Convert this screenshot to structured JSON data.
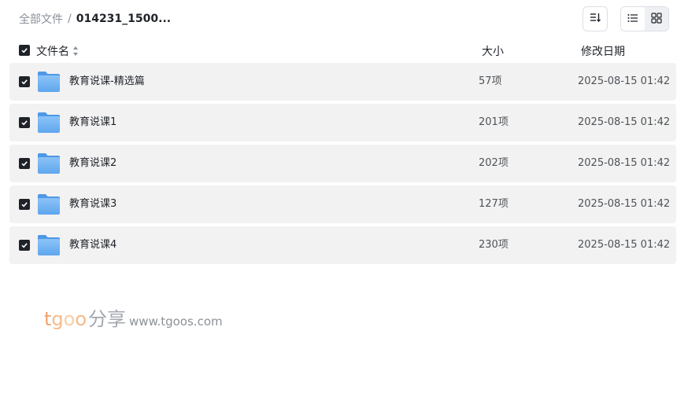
{
  "breadcrumb": {
    "root": "全部文件",
    "separator": "/",
    "current": "014231_1500..."
  },
  "toolbar": {
    "sort_icon": "sort-descending-icon",
    "view_list_icon": "list-view-icon",
    "view_grid_icon": "grid-view-icon",
    "active_view": "list"
  },
  "table": {
    "headers": {
      "name": "文件名",
      "size": "大小",
      "date": "修改日期"
    },
    "select_all_checked": true,
    "rows": [
      {
        "name": "教育说课-精选篇",
        "size": "57项",
        "date": "2025-08-15 01:42",
        "checked": true,
        "icon": "folder-icon"
      },
      {
        "name": "教育说课1",
        "size": "201项",
        "date": "2025-08-15 01:42",
        "checked": true,
        "icon": "folder-icon"
      },
      {
        "name": "教育说课2",
        "size": "202项",
        "date": "2025-08-15 01:42",
        "checked": true,
        "icon": "folder-icon"
      },
      {
        "name": "教育说课3",
        "size": "127项",
        "date": "2025-08-15 01:42",
        "checked": true,
        "icon": "folder-icon"
      },
      {
        "name": "教育说课4",
        "size": "230项",
        "date": "2025-08-15 01:42",
        "checked": true,
        "icon": "folder-icon"
      }
    ]
  },
  "watermark": {
    "brand_t": "t",
    "brand_g": "g",
    "brand_o1": "o",
    "brand_o2": "o",
    "brand_cn": "分享",
    "url": "www.tgoos.com"
  },
  "colors": {
    "row_background": "#f2f2f2",
    "checkbox": "#1f2329",
    "folder_blue": "#6aaef0",
    "watermark_orange": "#f2a36b"
  }
}
